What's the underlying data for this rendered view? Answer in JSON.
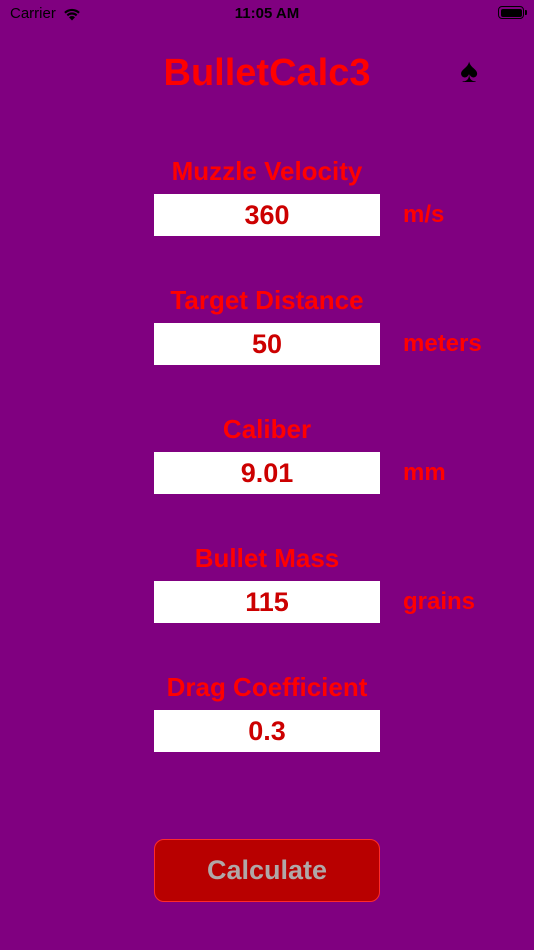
{
  "status_bar": {
    "carrier": "Carrier",
    "time": "11:05 AM",
    "wifi_icon": "wifi-icon",
    "battery_icon": "battery-full-icon"
  },
  "header": {
    "title": "BulletCalc3",
    "menu_icon": "spade-icon",
    "menu_glyph": "♠"
  },
  "fields": {
    "muzzle_velocity": {
      "label": "Muzzle Velocity",
      "value": "360",
      "unit": "m/s"
    },
    "target_distance": {
      "label": "Target Distance",
      "value": "50",
      "unit": "meters"
    },
    "caliber": {
      "label": "Caliber",
      "value": "9.01",
      "unit": "mm"
    },
    "bullet_mass": {
      "label": "Bullet Mass",
      "value": "115",
      "unit": "grains"
    },
    "drag_coefficient": {
      "label": "Drag Coefficient",
      "value": "0.3"
    }
  },
  "actions": {
    "calculate_label": "Calculate"
  },
  "colors": {
    "background": "#800080",
    "label_red": "#ff0000",
    "value_red": "#cc0000",
    "button_fill": "#b80000",
    "button_text": "#b0a8a8"
  }
}
